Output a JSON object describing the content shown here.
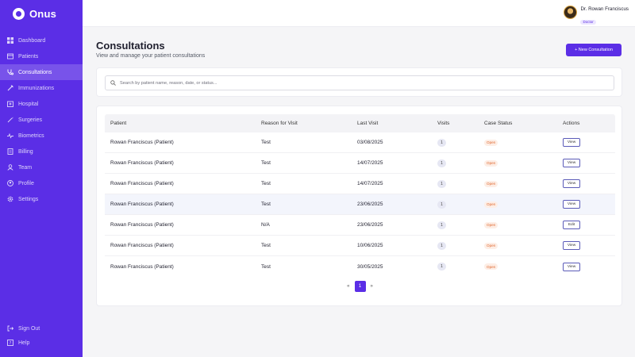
{
  "app": {
    "name": "Onus"
  },
  "sidebar": {
    "items": [
      {
        "label": "Dashboard",
        "icon": "grid-icon"
      },
      {
        "label": "Patients",
        "icon": "patients-icon"
      },
      {
        "label": "Consultations",
        "icon": "stethoscope-icon",
        "active": true
      },
      {
        "label": "Immunizations",
        "icon": "syringe-icon"
      },
      {
        "label": "Hospital",
        "icon": "hospital-icon"
      },
      {
        "label": "Surgeries",
        "icon": "scalpel-icon"
      },
      {
        "label": "Biometrics",
        "icon": "pulse-icon"
      },
      {
        "label": "Billing",
        "icon": "billing-icon"
      },
      {
        "label": "Team",
        "icon": "team-icon"
      },
      {
        "label": "Profile",
        "icon": "profile-icon"
      },
      {
        "label": "Settings",
        "icon": "gear-icon"
      }
    ],
    "bottom": [
      {
        "label": "Sign Out",
        "icon": "sign-out-icon"
      },
      {
        "label": "Help",
        "icon": "help-icon"
      }
    ]
  },
  "user": {
    "name": "Dr. Rowan Franciscus",
    "role": "Doctor"
  },
  "page": {
    "title": "Consultations",
    "subtitle": "View and manage your patient consultations",
    "new_button": "+ New Consultation"
  },
  "search": {
    "placeholder": "Search by patient name, reason, date, or status..."
  },
  "table": {
    "headers": [
      "Patient",
      "Reason for Visit",
      "Last Visit",
      "Visits",
      "Case Status",
      "Actions"
    ],
    "rows": [
      {
        "patient": "Rowan Franciscus (Patient)",
        "reason": "Test",
        "last_visit": "03/08/2025",
        "visits": "1",
        "status": "Open",
        "action": "View"
      },
      {
        "patient": "Rowan Franciscus (Patient)",
        "reason": "Test",
        "last_visit": "14/07/2025",
        "visits": "1",
        "status": "Open",
        "action": "View"
      },
      {
        "patient": "Rowan Franciscus (Patient)",
        "reason": "Test",
        "last_visit": "14/07/2025",
        "visits": "1",
        "status": "Open",
        "action": "View"
      },
      {
        "patient": "Rowan Franciscus (Patient)",
        "reason": "Test",
        "last_visit": "23/06/2025",
        "visits": "1",
        "status": "Open",
        "action": "View"
      },
      {
        "patient": "Rowan Franciscus (Patient)",
        "reason": "N/A",
        "last_visit": "23/06/2025",
        "visits": "1",
        "status": "Open",
        "action": "Edit"
      },
      {
        "patient": "Rowan Franciscus (Patient)",
        "reason": "Test",
        "last_visit": "10/06/2025",
        "visits": "1",
        "status": "Open",
        "action": "View"
      },
      {
        "patient": "Rowan Franciscus (Patient)",
        "reason": "Test",
        "last_visit": "30/05/2025",
        "visits": "1",
        "status": "Open",
        "action": "View"
      }
    ]
  },
  "pagination": {
    "prev": "«",
    "current": "1",
    "next": "»"
  },
  "colors": {
    "accent": "#5b2ee6",
    "status_open": "#e0672e"
  }
}
